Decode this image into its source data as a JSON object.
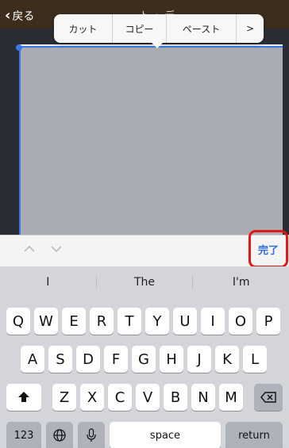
{
  "nav": {
    "back_label": "戻る",
    "title_fragment": "ー ト ・ デ"
  },
  "edit_menu": {
    "cut": "カット",
    "copy": "コピー",
    "paste": "ペースト",
    "more": ">"
  },
  "accessory": {
    "done": "完了"
  },
  "keyboard": {
    "predictions": [
      "I",
      "The",
      "I'm"
    ],
    "row1": [
      "Q",
      "W",
      "E",
      "R",
      "T",
      "Y",
      "U",
      "I",
      "O",
      "P"
    ],
    "row2": [
      "A",
      "S",
      "D",
      "F",
      "G",
      "H",
      "J",
      "K",
      "L"
    ],
    "row3": [
      "Z",
      "X",
      "C",
      "V",
      "B",
      "N",
      "M"
    ],
    "numbers_key": "123",
    "space_key": "space",
    "return_key": "return"
  },
  "colors": {
    "highlight": "#e01818",
    "accent": "#2f6fe0",
    "nav_bg": "#3c2d1d"
  }
}
